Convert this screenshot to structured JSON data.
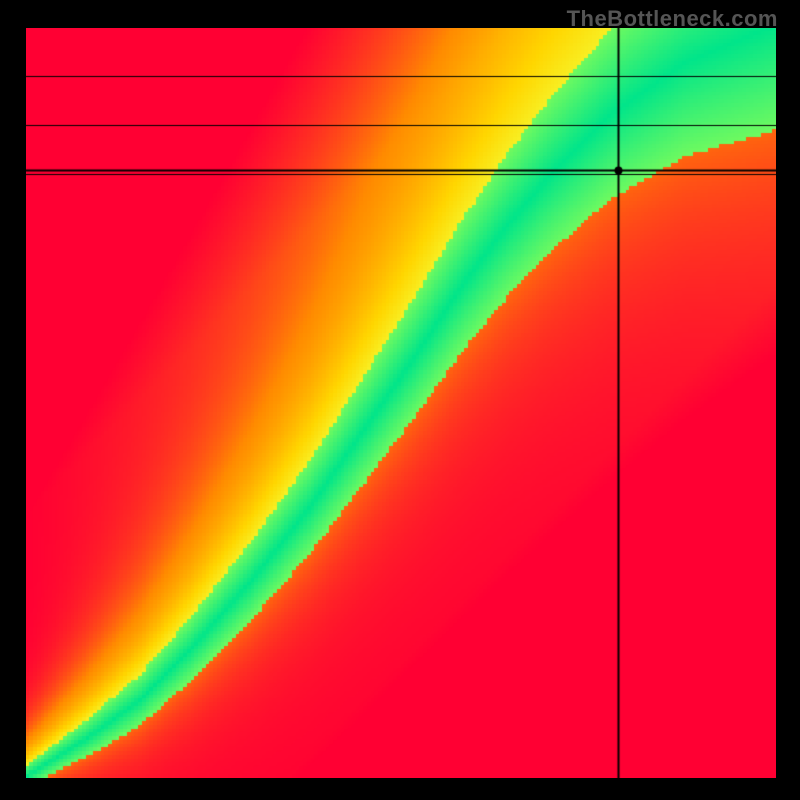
{
  "watermark": "TheBottleneck.com",
  "chart_data": {
    "type": "heatmap",
    "title": "",
    "xlabel": "",
    "ylabel": "",
    "xlim": [
      0,
      1
    ],
    "ylim": [
      0,
      1
    ],
    "colorscale": [
      {
        "stop": 0.0,
        "color": "#ff0033"
      },
      {
        "stop": 0.25,
        "color": "#ff8b00"
      },
      {
        "stop": 0.5,
        "color": "#ffd600"
      },
      {
        "stop": 0.7,
        "color": "#f3ff3a"
      },
      {
        "stop": 0.85,
        "color": "#8aff55"
      },
      {
        "stop": 1.0,
        "color": "#00e58a"
      }
    ],
    "ridge": {
      "comment": "Approximate center of the green ridge as (x, y) pairs in normalized [0,1] coords, origin bottom-left.",
      "points": [
        [
          0.0,
          0.0
        ],
        [
          0.08,
          0.05
        ],
        [
          0.15,
          0.1
        ],
        [
          0.22,
          0.17
        ],
        [
          0.3,
          0.26
        ],
        [
          0.38,
          0.36
        ],
        [
          0.45,
          0.46
        ],
        [
          0.52,
          0.56
        ],
        [
          0.58,
          0.65
        ],
        [
          0.64,
          0.73
        ],
        [
          0.7,
          0.8
        ],
        [
          0.78,
          0.88
        ],
        [
          0.88,
          0.95
        ],
        [
          1.0,
          1.0
        ]
      ],
      "width_start": 0.015,
      "width_end": 0.14
    },
    "crosshair": {
      "x": 0.79,
      "y": 0.81
    },
    "marker": {
      "x": 0.79,
      "y": 0.81,
      "r": 4
    },
    "resolution": 200
  }
}
